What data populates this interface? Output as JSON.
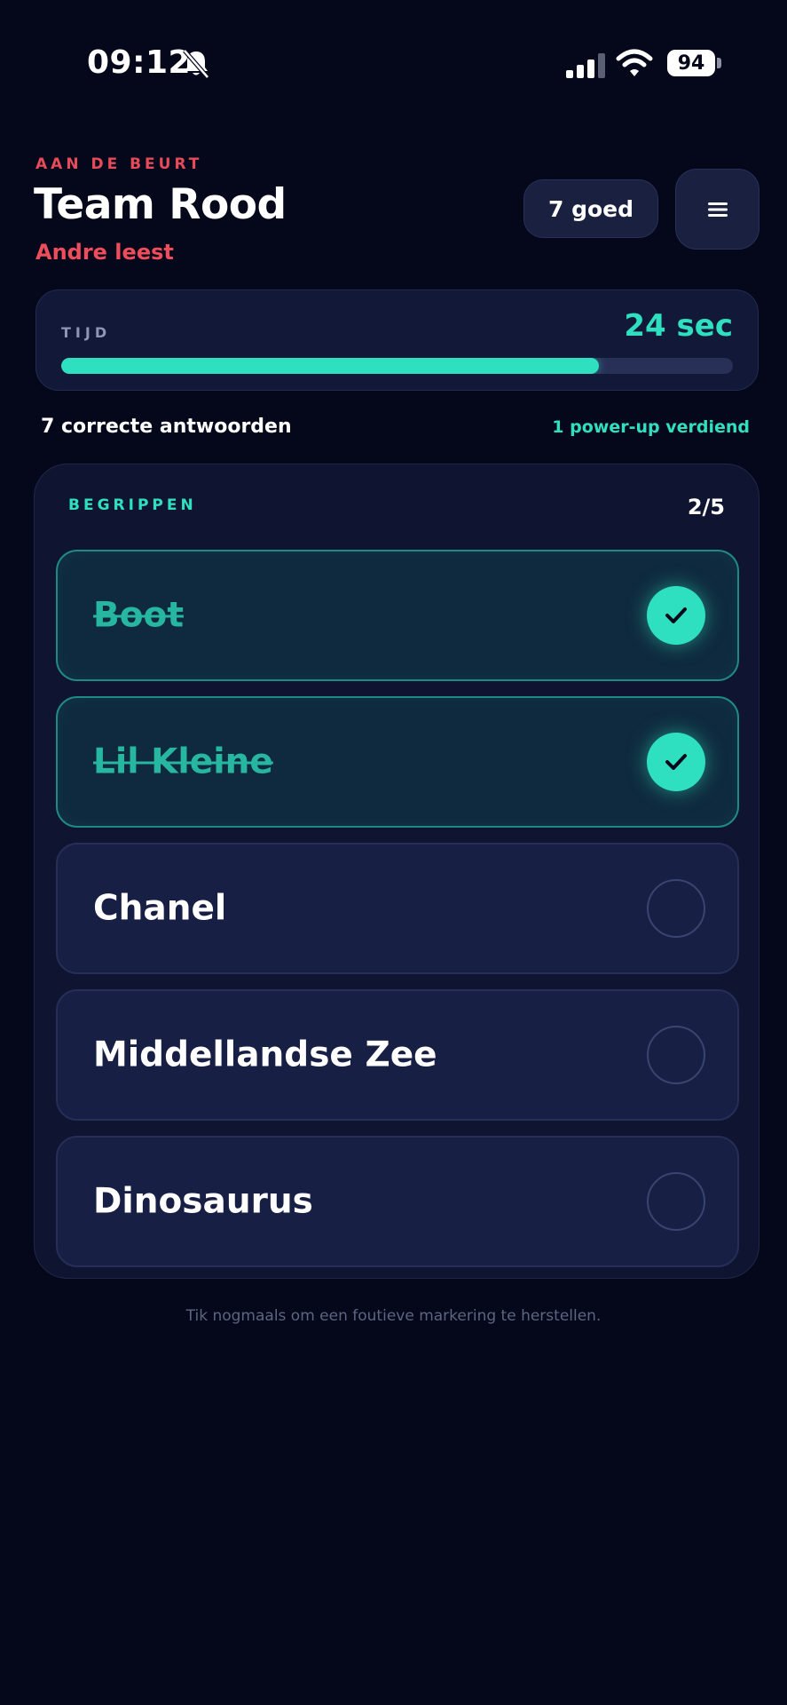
{
  "status_bar": {
    "time": "09:12",
    "battery": "94",
    "icons": [
      "bell-slash-icon",
      "signal-icon",
      "wifi-icon",
      "battery-icon"
    ]
  },
  "header": {
    "turn_label": "AAN DE BEURT",
    "team": "Team Rood",
    "reader": "Andre leest",
    "score_label": "7 goed",
    "menu_icon": "hamburger-menu-icon"
  },
  "timer": {
    "label": "TIJD",
    "value": "24 sec",
    "fraction": 0.8
  },
  "stats": {
    "correct": "7 correcte antwoorden",
    "powerup": "1 power-up verdiend"
  },
  "words": {
    "title": "BEGRIPPEN",
    "progress": "2/5",
    "items": [
      {
        "label": "Boot",
        "done": true
      },
      {
        "label": "Lil Kleine",
        "done": true
      },
      {
        "label": "Chanel",
        "done": false
      },
      {
        "label": "Middellandse Zee",
        "done": false
      },
      {
        "label": "Dinosaurus",
        "done": false
      }
    ]
  },
  "hint": "Tik nogmaals om een foutieve markering te herstellen.",
  "colors": {
    "background": "#05081a",
    "accent_teal": "#2fe0c0",
    "accent_red": "#e54b5a",
    "card": "#121838"
  }
}
